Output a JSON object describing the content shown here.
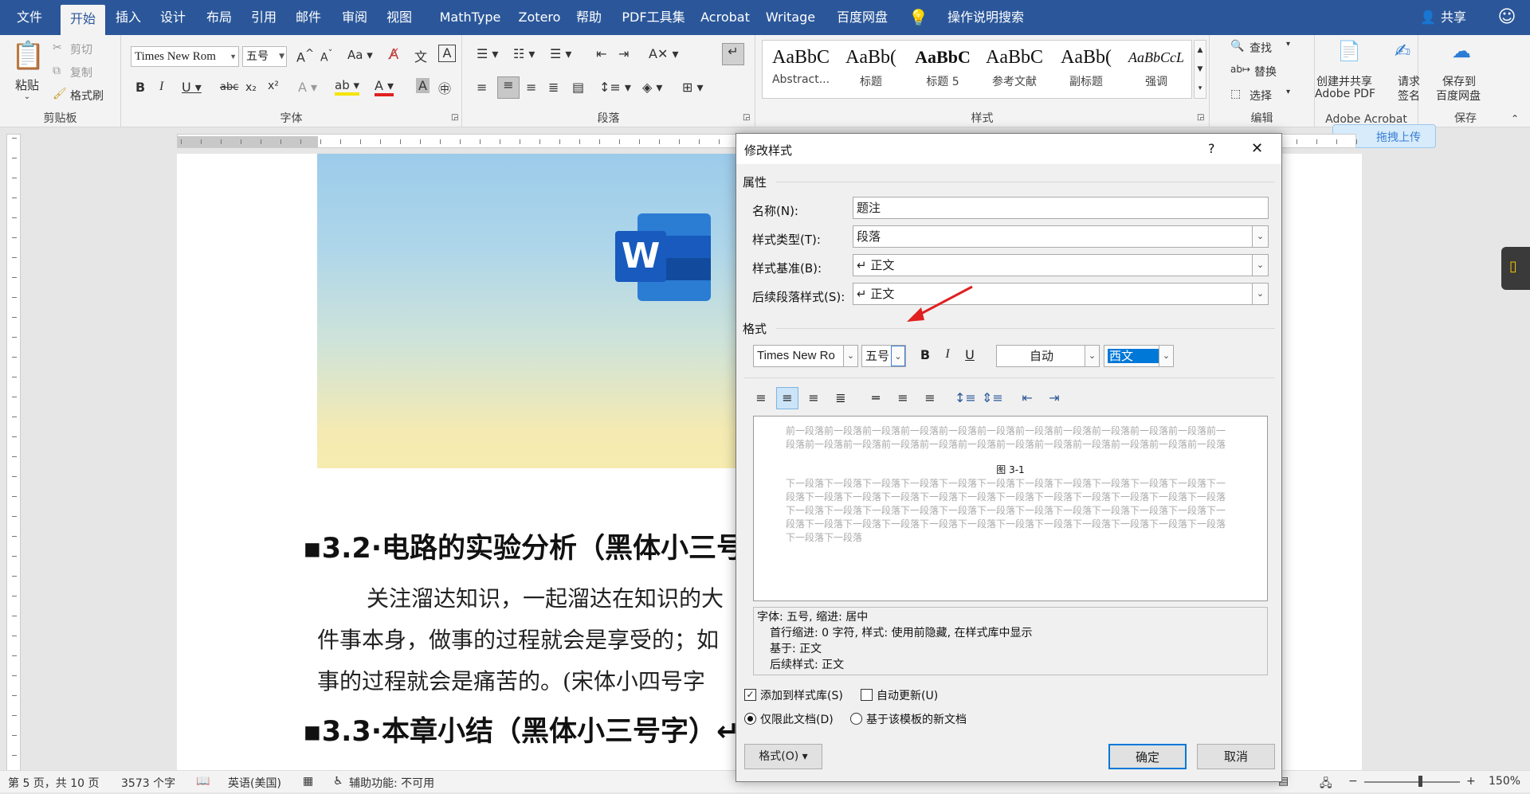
{
  "tabs": [
    "文件",
    "开始",
    "插入",
    "设计",
    "布局",
    "引用",
    "邮件",
    "审阅",
    "视图",
    "MathType",
    "Zotero",
    "帮助",
    "PDF工具集",
    "Acrobat",
    "Writage",
    "百度网盘"
  ],
  "tell_me": "操作说明搜索",
  "share": "共享",
  "ribbon": {
    "clipboard": {
      "paste": "粘贴",
      "cut": "剪切",
      "copy": "复制",
      "format_painter": "格式刷",
      "label": "剪贴板"
    },
    "font": {
      "family": "Times New Rom",
      "size": "五号",
      "label": "字体"
    },
    "paragraph": {
      "label": "段落"
    },
    "styles": {
      "items": [
        {
          "sample": "AaBbC",
          "name": "Abstract..."
        },
        {
          "sample": "AaBb(",
          "name": "标题"
        },
        {
          "sample": "AaBbC",
          "name": "标题 5"
        },
        {
          "sample": "AaBbC",
          "name": "参考文献"
        },
        {
          "sample": "AaBb(",
          "name": "副标题"
        },
        {
          "sample": "AaBbCcL",
          "name": "强调"
        }
      ],
      "label": "样式"
    },
    "editing": {
      "find": "查找",
      "replace": "替换",
      "select": "选择",
      "label": "编辑"
    },
    "acrobat": {
      "create_share": "创建并共享",
      "adobe_pdf": "Adobe PDF",
      "request": "请求",
      "sign": "签名",
      "label": "Adobe Acrobat"
    },
    "save": {
      "save_to": "保存到",
      "baidu": "百度网盘",
      "label": "保存"
    }
  },
  "upload_btn": "拖拽上传",
  "document": {
    "heading1": "▪3.2·电路的实验分析（黑体小三号",
    "para1": "关注溜达知识，一起溜达在知识的大",
    "para2": "件事本身，做事的过程就会是享受的；如",
    "para3": "事的过程就会是痛苦的。(宋体小四号字",
    "heading2": "▪3.3·本章小结（黑体小三号字）↵"
  },
  "statusbar": {
    "page": "第 5 页，共 10 页",
    "words": "3573 个字",
    "lang": "英语(美国)",
    "access": "辅助功能: 不可用",
    "zoom": "150%"
  },
  "dialog": {
    "title": "修改样式",
    "help": "?",
    "close": "✕",
    "props_label": "属性",
    "name_label": "名称(N):",
    "name_value": "题注",
    "type_label": "样式类型(T):",
    "type_value": "段落",
    "based_label": "样式基准(B):",
    "based_value": "↵ 正文",
    "next_label": "后续段落样式(S):",
    "next_value": "↵ 正文",
    "format_label": "格式",
    "font": "Times New Ro",
    "size": "五号",
    "bold": "B",
    "italic": "I",
    "underline": "U",
    "color": "自动",
    "script": "西文",
    "preview_prev": "前一段落前一段落前一段落前一段落前一段落前一段落前一段落前一段落前一段落前一段落前一段落前一段落前一段落前一段落前一段落前一段落前一段落前一段落前一段落前一段落前一段落前一段落前一段落",
    "preview_caption": "图 3-1",
    "preview_next": "下一段落下一段落下一段落下一段落下一段落下一段落下一段落下一段落下一段落下一段落下一段落下一段落下一段落下一段落下一段落下一段落下一段落下一段落下一段落下一段落下一段落下一段落下一段落下一段落下一段落下一段落下一段落下一段落下一段落下一段落下一段落下一段落下一段落下一段落下一段落下一段落下一段落下一段落下一段落下一段落下一段落下一段落下一段落下一段落下一段落下一段落下一段落下一段落",
    "desc1": "字体: 五号, 缩进: 居中",
    "desc2": "首行缩进:  0 字符, 样式: 使用前隐藏, 在样式库中显示",
    "desc3": "基于: 正文",
    "desc4": "后续样式: 正文",
    "add_gallery": "添加到样式库(S)",
    "auto_update": "自动更新(U)",
    "only_doc": "仅限此文档(D)",
    "new_docs": "基于该模板的新文档",
    "format_btn": "格式(O) ▾",
    "ok": "确定",
    "cancel": "取消"
  }
}
